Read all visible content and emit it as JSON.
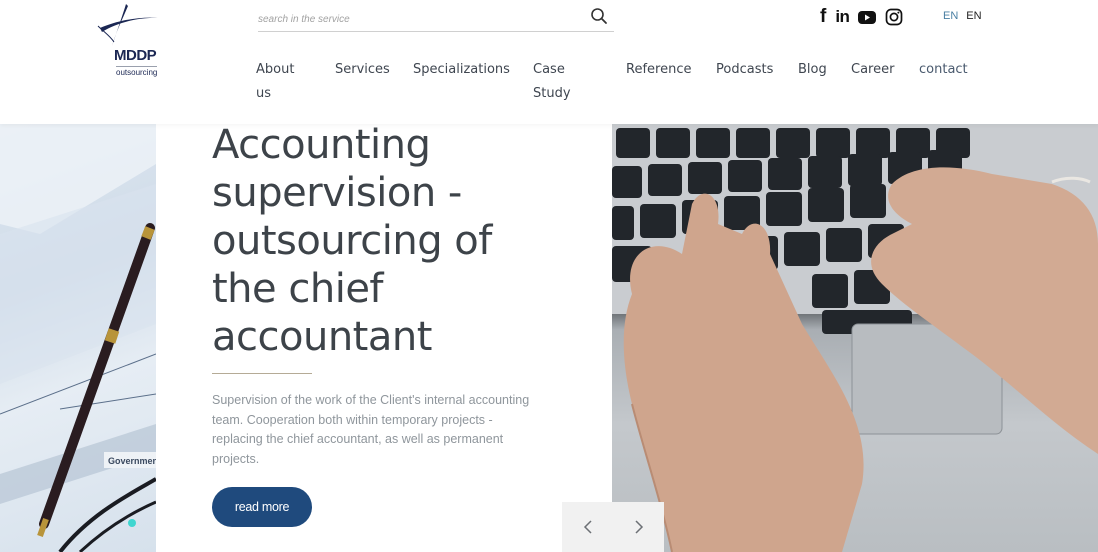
{
  "brand": {
    "name": "MDDP",
    "tagline": "outsourcing",
    "primary_color": "#1b2753",
    "accent_color": "#1f4a7d"
  },
  "search": {
    "placeholder": "search in the service",
    "value": "",
    "icon": "search-icon"
  },
  "social": [
    {
      "name": "facebook",
      "glyph": "f"
    },
    {
      "name": "linkedin",
      "glyph": "in"
    },
    {
      "name": "youtube",
      "glyph": "youtube"
    },
    {
      "name": "instagram",
      "glyph": "instagram"
    }
  ],
  "languages": {
    "active": "EN",
    "other": "EN"
  },
  "nav": {
    "items": [
      {
        "label_line1": "About",
        "label_line2": "us"
      },
      {
        "label_line1": "Services",
        "label_line2": ""
      },
      {
        "label_line1": "Specializations",
        "label_line2": ""
      },
      {
        "label_line1": "Case",
        "label_line2": "Study"
      },
      {
        "label_line1": "Reference",
        "label_line2": ""
      },
      {
        "label_line1": "Podcasts",
        "label_line2": ""
      },
      {
        "label_line1": "Blog",
        "label_line2": ""
      },
      {
        "label_line1": "Career",
        "label_line2": ""
      },
      {
        "label_line1": "contact",
        "label_line2": ""
      }
    ]
  },
  "hero": {
    "title_lines": [
      "Accounting",
      "supervision -",
      "outsourcing of",
      "the chief",
      "accountant"
    ],
    "description": "Supervision of the work of the Client's internal accounting team. Cooperation both within temporary projects - replacing the chief accountant, as well as permanent projects.",
    "cta_label": "read more",
    "left_image_alt": "pen lying on financial documents",
    "right_image_alt": "hands typing on laptop keyboard",
    "left_image_text": "Governmen"
  },
  "slider": {
    "prev_glyph": "‹",
    "next_glyph": "›"
  }
}
